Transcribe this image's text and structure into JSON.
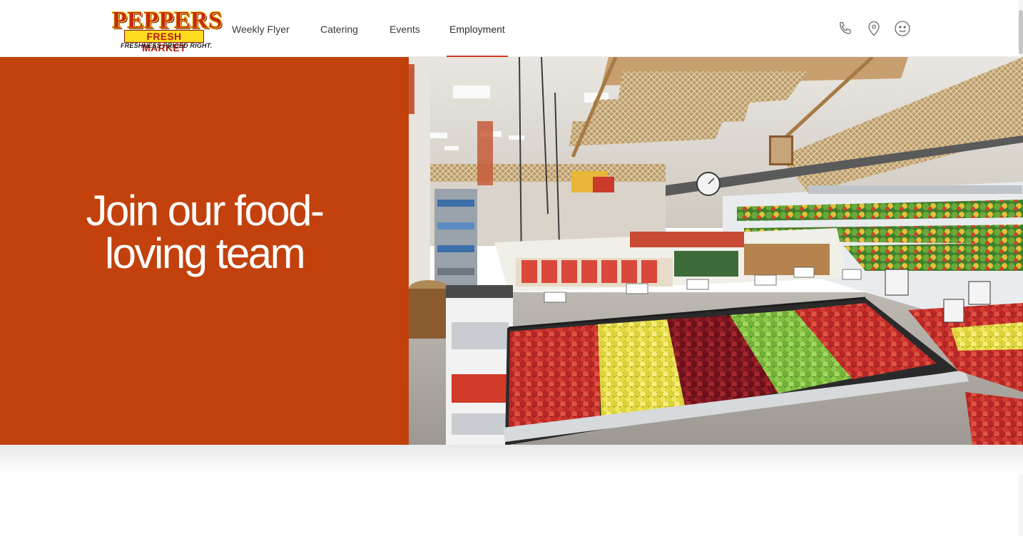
{
  "header": {
    "logo": {
      "line1": "PEPPERS",
      "line2": "FRESH MARKET",
      "tagline": "FRESHNESS PRICED RIGHT."
    },
    "nav": [
      {
        "label": "Weekly Flyer",
        "active": false
      },
      {
        "label": "Catering",
        "active": false
      },
      {
        "label": "Events",
        "active": false
      },
      {
        "label": "Employment",
        "active": true
      }
    ],
    "icons": [
      "phone-icon",
      "location-pin-icon",
      "smiley-icon"
    ],
    "accent_color": "#d23a1f"
  },
  "hero": {
    "title_line1": "Join our food-",
    "title_line2": "loving team",
    "panel_color": "#c2410c",
    "image_subject": "grocery-produce-department"
  }
}
